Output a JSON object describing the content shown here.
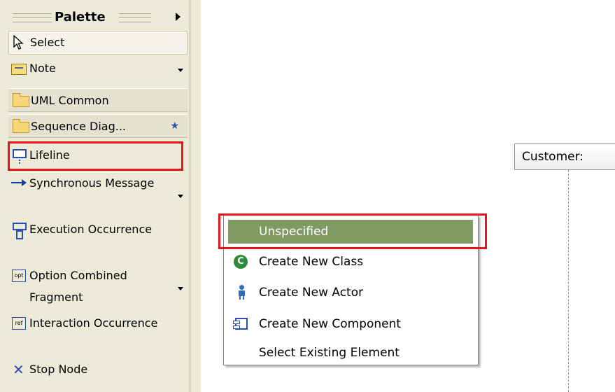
{
  "palette": {
    "title": "Palette",
    "select_label": "Select",
    "note_label": "Note",
    "drawers": [
      {
        "label": "UML Common"
      },
      {
        "label": "Sequence Diag..."
      }
    ],
    "tools": [
      {
        "label": "Lifeline"
      },
      {
        "label": "Synchronous Message"
      },
      {
        "label": "Execution Occurrence"
      },
      {
        "label": "Option Combined Fragment"
      },
      {
        "label": "Interaction Occurrence"
      },
      {
        "label": "Stop Node"
      }
    ],
    "frag_icon_text": "opt",
    "ref_icon_text": "ref"
  },
  "canvas": {
    "lifeline_title": "Customer:"
  },
  "popup": {
    "items": [
      {
        "label": "Unspecified"
      },
      {
        "label": "Create New Class"
      },
      {
        "label": "Create New Actor"
      },
      {
        "label": "Create New Component"
      },
      {
        "label": "Select Existing Element"
      }
    ]
  },
  "colors": {
    "highlight": "#e8141b",
    "selected_item": "#7f9b63",
    "palette_bg": "#ecead8"
  }
}
